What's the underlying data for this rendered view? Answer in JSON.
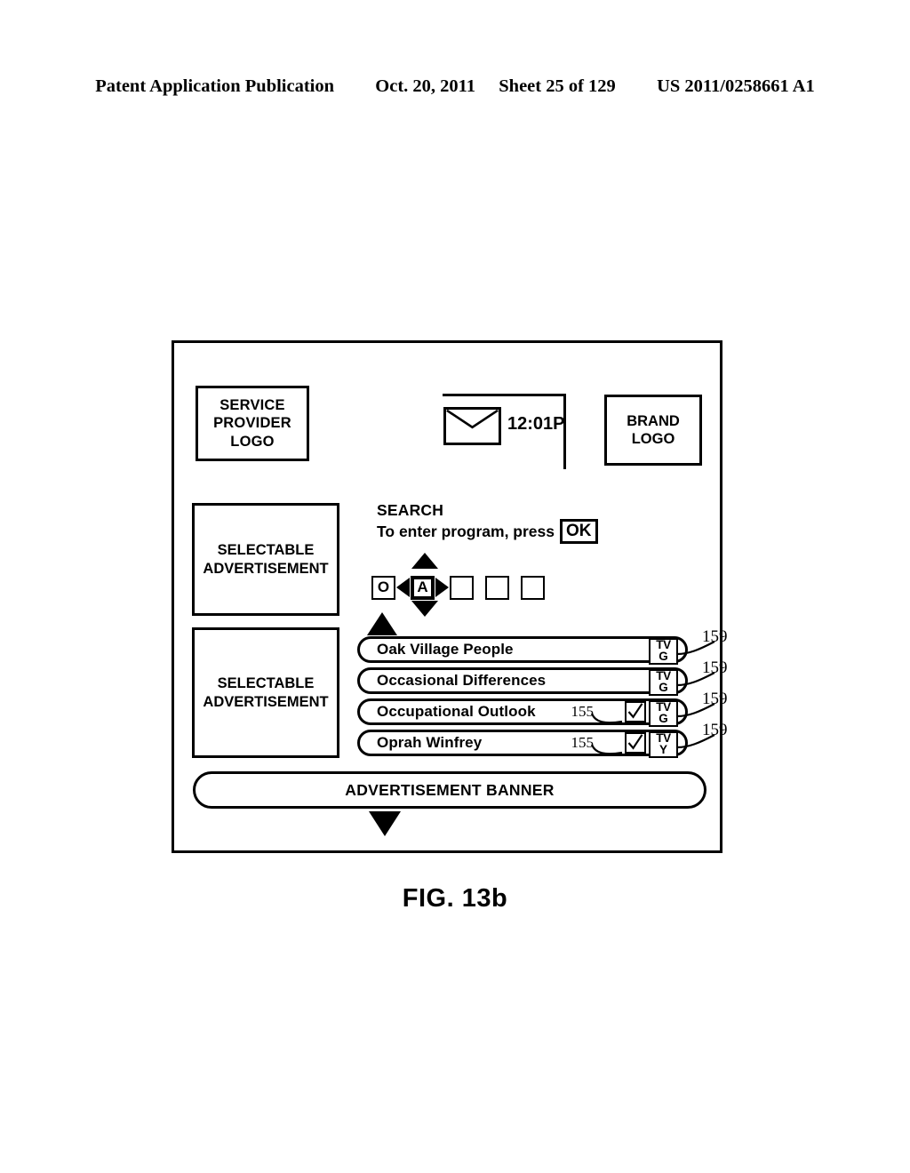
{
  "page_header": {
    "publication": "Patent Application Publication",
    "date": "Oct. 20, 2011",
    "sheet": "Sheet 25 of 129",
    "document_number": "US 2011/0258661 A1"
  },
  "figure": {
    "caption": "FIG. 13b",
    "service_provider_logo": "SERVICE PROVIDER LOGO",
    "brand_logo": "BRAND LOGO",
    "status_bar": {
      "mail_icon": "envelope-icon",
      "time": "12:01P"
    },
    "selectable_ads": [
      "SELECTABLE ADVERTISEMENT",
      "SELECTABLE ADVERTISEMENT"
    ],
    "search": {
      "title": "SEARCH",
      "instruction": "To enter program, press",
      "ok_label": "OK",
      "entry_cells": [
        {
          "value": "O",
          "selected": false
        },
        {
          "value": "A",
          "selected": true
        },
        {
          "value": "",
          "selected": false
        },
        {
          "value": "",
          "selected": false
        },
        {
          "value": "",
          "selected": false
        }
      ],
      "dpad": {
        "up": "triangle-up-icon",
        "down": "triangle-down-icon",
        "left": "triangle-left-icon",
        "right": "triangle-right-icon"
      }
    },
    "scroll": {
      "up": "scroll-up-arrow-icon",
      "down": "scroll-down-arrow-icon"
    },
    "program_list": [
      {
        "title": "Oak Village People",
        "rating_top": "TV",
        "rating_bottom": "G",
        "has_record_check": false,
        "ref_155": "",
        "ref_159": "159"
      },
      {
        "title": "Occasional Differences",
        "rating_top": "TV",
        "rating_bottom": "G",
        "has_record_check": false,
        "ref_155": "",
        "ref_159": "159"
      },
      {
        "title": "Occupational Outlook",
        "rating_top": "TV",
        "rating_bottom": "G",
        "has_record_check": true,
        "ref_155": "155",
        "ref_159": "159"
      },
      {
        "title": "Oprah Winfrey",
        "rating_top": "TV",
        "rating_bottom": "Y",
        "has_record_check": true,
        "ref_155": "155",
        "ref_159": "159"
      }
    ],
    "ad_banner": "ADVERTISEMENT BANNER"
  }
}
